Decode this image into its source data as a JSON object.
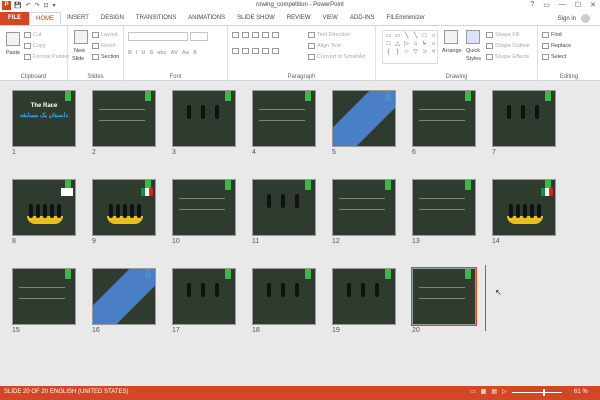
{
  "window": {
    "title": "rowing_competition - PowerPoint",
    "controls": [
      "?",
      "▭",
      "—",
      "☐",
      "✕"
    ],
    "app_icon": "P"
  },
  "qat": [
    "💾",
    "↶",
    "↷",
    "⊡",
    "▾"
  ],
  "tabs": [
    "FILE",
    "HOME",
    "INSERT",
    "DESIGN",
    "TRANSITIONS",
    "ANIMATIONS",
    "SLIDE SHOW",
    "REVIEW",
    "VIEW",
    "ADD-INS",
    "FILEminimizer"
  ],
  "signin": "Sign in",
  "ribbon": {
    "clipboard": {
      "label": "Clipboard",
      "paste": "Paste",
      "cut": "Cut",
      "copy": "Copy",
      "format_painter": "Format Painter"
    },
    "slides": {
      "label": "Slides",
      "new_slide": "New",
      "new_slide_2": "Slide",
      "layout": "Layout",
      "reset": "Reset",
      "section": "Section"
    },
    "font": {
      "label": "Font",
      "buttons": [
        "B",
        "I",
        "U",
        "S",
        "abc",
        "AV",
        "Aa",
        "A"
      ]
    },
    "paragraph": {
      "label": "Paragraph",
      "text_direction": "Text Direction",
      "align_text": "Align Text",
      "convert_smartart": "Convert to SmartArt"
    },
    "drawing": {
      "label": "Drawing",
      "arrange": "Arrange",
      "quick_styles": "Quick",
      "quick_styles_2": "Styles",
      "shape_fill": "Shape Fill",
      "shape_outline": "Shape Outline",
      "shape_effects": "Shape Effects"
    },
    "shapes": [
      "▭",
      "▭",
      "╲",
      "╲",
      "□",
      "○",
      "□",
      "△",
      "▷",
      "⌂",
      "↳",
      "⌂",
      "{",
      "}",
      "☆",
      "▽",
      "⊃",
      "▿"
    ],
    "editing": {
      "label": "Editing",
      "find": "Find",
      "replace": "Replace",
      "select": "Select"
    }
  },
  "slides": [
    {
      "num": "1",
      "title": "The Race",
      "subtitle": "دانستان يک مسابقه"
    },
    {
      "num": "2"
    },
    {
      "num": "3"
    },
    {
      "num": "4"
    },
    {
      "num": "5"
    },
    {
      "num": "6"
    },
    {
      "num": "7"
    },
    {
      "num": "8"
    },
    {
      "num": "9"
    },
    {
      "num": "10"
    },
    {
      "num": "11"
    },
    {
      "num": "12"
    },
    {
      "num": "13"
    },
    {
      "num": "14"
    },
    {
      "num": "15"
    },
    {
      "num": "16"
    },
    {
      "num": "17"
    },
    {
      "num": "18"
    },
    {
      "num": "19"
    },
    {
      "num": "20"
    }
  ],
  "status": {
    "slide_counter": "SLIDE 20 OF 20",
    "language": "ENGLISH (UNITED STATES)",
    "zoom": "61 %",
    "zoom_level": 0.61
  },
  "colors": {
    "accent": "#d24726",
    "slide_bg": "#2e3b2e",
    "tag_green": "#3fb54a"
  }
}
